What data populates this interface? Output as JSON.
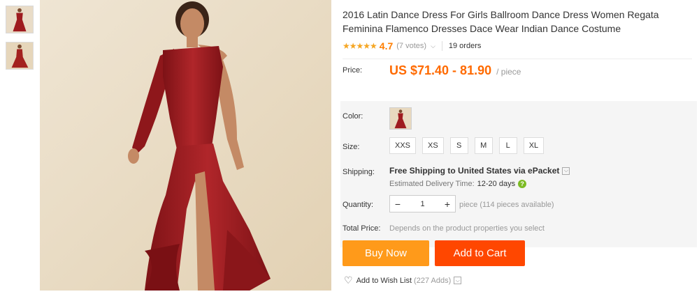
{
  "product": {
    "title": "2016 Latin Dance Dress For Girls Ballroom Dance Dress Women Regata Feminina Flamenco Dresses Dace Wear Indian Dance Costume",
    "rating": "4.7",
    "votes": "(7 votes)",
    "orders": "19 orders"
  },
  "price": {
    "label": "Price:",
    "range": "US $71.40 - 81.90",
    "per": "/ piece"
  },
  "color": {
    "label": "Color:"
  },
  "size": {
    "label": "Size:",
    "options": [
      "XXS",
      "XS",
      "S",
      "M",
      "L",
      "XL"
    ]
  },
  "shipping": {
    "label": "Shipping:",
    "text": "Free Shipping to United States via ePacket",
    "estimate_label": "Estimated Delivery Time:",
    "estimate_days": "12-20 days"
  },
  "quantity": {
    "label": "Quantity:",
    "value": "1",
    "minus": "−",
    "plus": "+",
    "unit": "piece",
    "available": "(114 pieces available)"
  },
  "total": {
    "label": "Total Price:",
    "text": "Depends on the product properties you select"
  },
  "buttons": {
    "buy_now": "Buy Now",
    "add_to_cart": "Add to Cart"
  },
  "wishlist": {
    "label": "Add to Wish List",
    "count": "(227 Adds)"
  },
  "colors": {
    "price": "#ff6a00",
    "buy_now": "#ff9a1a",
    "add_to_cart": "#ff4700",
    "stars": "#f5a623",
    "dress": "#9e1b1f"
  },
  "icons": {
    "stars": "star-icon",
    "heart": "heart-icon",
    "chevron": "chevron-down-icon",
    "help": "help-icon"
  }
}
